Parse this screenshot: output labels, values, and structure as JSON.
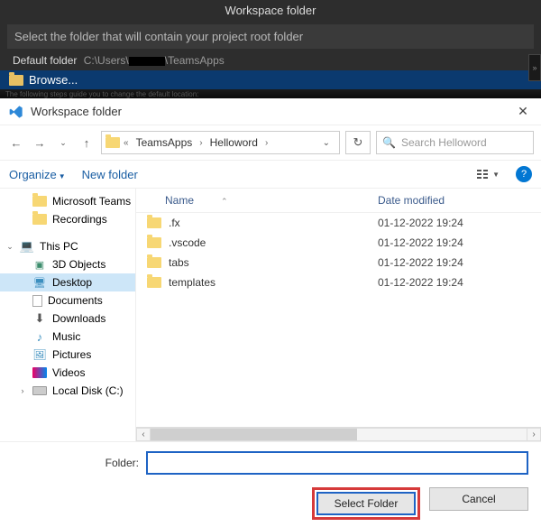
{
  "top": {
    "title": "Workspace folder",
    "instruction": "Select the folder that will contain your project root folder",
    "default_label": "Default folder",
    "default_path_prefix": "C:\\Users\\",
    "default_path_suffix": "\\TeamsApps",
    "browse": "Browse...",
    "hidden_text": "The following steps guide you to change the default location:"
  },
  "dialog": {
    "title": "Workspace folder",
    "close": "✕"
  },
  "nav": {
    "back": "←",
    "forward": "→",
    "recent": "⌄",
    "up": "↑",
    "refresh": "↻"
  },
  "breadcrumb": {
    "items": [
      "TeamsApps",
      "Helloword"
    ]
  },
  "search": {
    "placeholder": "Search Helloword",
    "icon": "🔍"
  },
  "toolbar": {
    "organize": "Organize",
    "new_folder": "New folder",
    "help": "?"
  },
  "tree": {
    "items": [
      {
        "label": "Microsoft Teams",
        "icon": "folder",
        "level": 1
      },
      {
        "label": "Recordings",
        "icon": "folder",
        "level": 1
      },
      {
        "label": "This PC",
        "icon": "pc",
        "level": 0,
        "expandable": true
      },
      {
        "label": "3D Objects",
        "icon": "3d",
        "level": 1
      },
      {
        "label": "Desktop",
        "icon": "desk",
        "level": 1,
        "selected": true
      },
      {
        "label": "Documents",
        "icon": "doc",
        "level": 1
      },
      {
        "label": "Downloads",
        "icon": "down",
        "level": 1
      },
      {
        "label": "Music",
        "icon": "music",
        "level": 1
      },
      {
        "label": "Pictures",
        "icon": "pic",
        "level": 1
      },
      {
        "label": "Videos",
        "icon": "vid",
        "level": 1
      },
      {
        "label": "Local Disk (C:)",
        "icon": "disk",
        "level": 1,
        "expandable": true
      }
    ]
  },
  "columns": {
    "name": "Name",
    "date": "Date modified"
  },
  "files": [
    {
      "name": ".fx",
      "date": "01-12-2022 19:24"
    },
    {
      "name": ".vscode",
      "date": "01-12-2022 19:24"
    },
    {
      "name": "tabs",
      "date": "01-12-2022 19:24"
    },
    {
      "name": "templates",
      "date": "01-12-2022 19:24"
    }
  ],
  "footer": {
    "folder_label": "Folder:",
    "folder_value": "",
    "select": "Select Folder",
    "cancel": "Cancel"
  }
}
